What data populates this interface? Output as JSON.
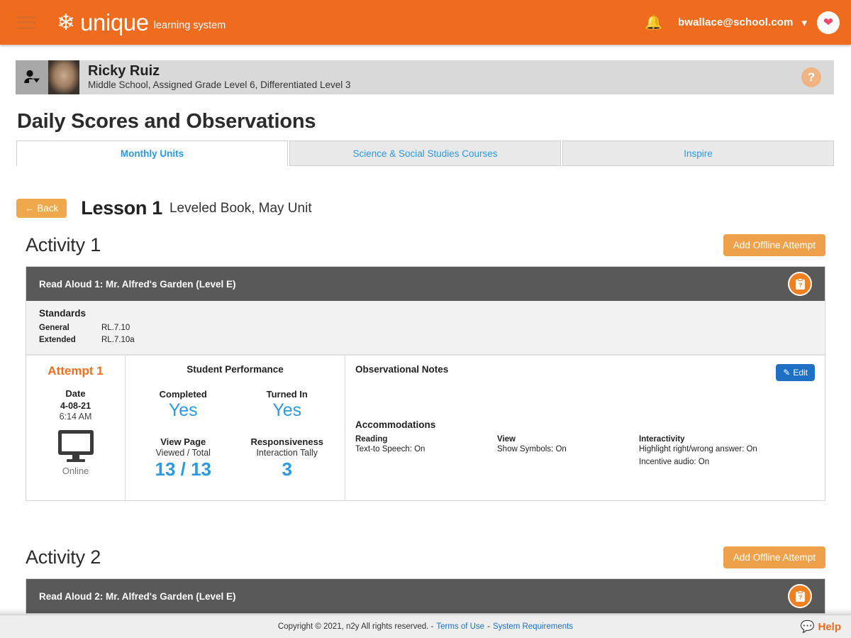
{
  "topbar": {
    "menu_icon": "hamburger-icon",
    "logo_icon": "snowflake-icon",
    "brand_main": "unique",
    "brand_sub": "learning system",
    "bell_icon": "bell-icon",
    "user_email": "bwallace@school.com",
    "caret_icon": "chevron-down-icon",
    "favorite_icon": "heart-icon",
    "accent_color": "#ef6c1f"
  },
  "student": {
    "avatar_icon": "user-switch-icon",
    "photo_alt": "student-photo",
    "name": "Ricky Ruiz",
    "details": "Middle School, Assigned Grade Level 6, Differentiated Level 3",
    "help_icon": "question-mark-icon"
  },
  "page": {
    "title": "Daily Scores and Observations"
  },
  "tabs": [
    {
      "label": "Monthly Units",
      "active": true
    },
    {
      "label": "Science & Social Studies Courses",
      "active": false
    },
    {
      "label": "Inspire",
      "active": false
    }
  ],
  "lesson": {
    "back_label": "Back",
    "back_icon": "arrow-left-icon",
    "title": "Lesson 1",
    "subtitle": "Leveled Book, May Unit"
  },
  "activities": [
    {
      "title": "Activity 1",
      "add_offline_label": "Add Offline Attempt",
      "bar_title": "Read Aloud 1: Mr. Alfred's Garden (Level E)",
      "info_icon": "clipboard-question-icon",
      "standards": {
        "heading": "Standards",
        "rows": [
          {
            "label": "General",
            "value": "RL.7.10"
          },
          {
            "label": "Extended",
            "value": "RL.7.10a"
          }
        ]
      },
      "attempt": {
        "heading": "Attempt 1",
        "date_label": "Date",
        "date_value": "4-08-21",
        "time_value": "6:14 AM",
        "mode_icon": "monitor-icon",
        "mode_label": "Online"
      },
      "performance": {
        "heading": "Student Performance",
        "completed_label": "Completed",
        "completed_value": "Yes",
        "turned_in_label": "Turned In",
        "turned_in_value": "Yes",
        "view_page_label": "View Page",
        "view_page_sub": "Viewed / Total",
        "view_page_value": "13 / 13",
        "responsiveness_label": "Responsiveness",
        "responsiveness_sub": "Interaction Tally",
        "responsiveness_value": "3"
      },
      "notes": {
        "heading": "Observational Notes",
        "body": "",
        "edit_label": "Edit",
        "edit_icon": "pencil-icon"
      },
      "accommodations": {
        "heading": "Accommodations",
        "columns": [
          {
            "title": "Reading",
            "items": [
              "Text-to Speech: On"
            ]
          },
          {
            "title": "View",
            "items": [
              "Show Symbols: On"
            ]
          },
          {
            "title": "Interactivity",
            "items": [
              "Highlight right/wrong answer: On",
              "Incentive audio: On"
            ]
          }
        ]
      }
    },
    {
      "title": "Activity 2",
      "add_offline_label": "Add Offline Attempt",
      "bar_title": "Read Aloud 2: Mr. Alfred's Garden (Level E)",
      "info_icon": "clipboard-question-icon"
    }
  ],
  "footer": {
    "copyright": "Copyright © 2021, n2y All rights reserved. -",
    "terms_label": "Terms of Use",
    "separator": "-",
    "requirements_label": "System Requirements",
    "help_label": "Help",
    "help_icon": "chat-bubble-icon"
  }
}
